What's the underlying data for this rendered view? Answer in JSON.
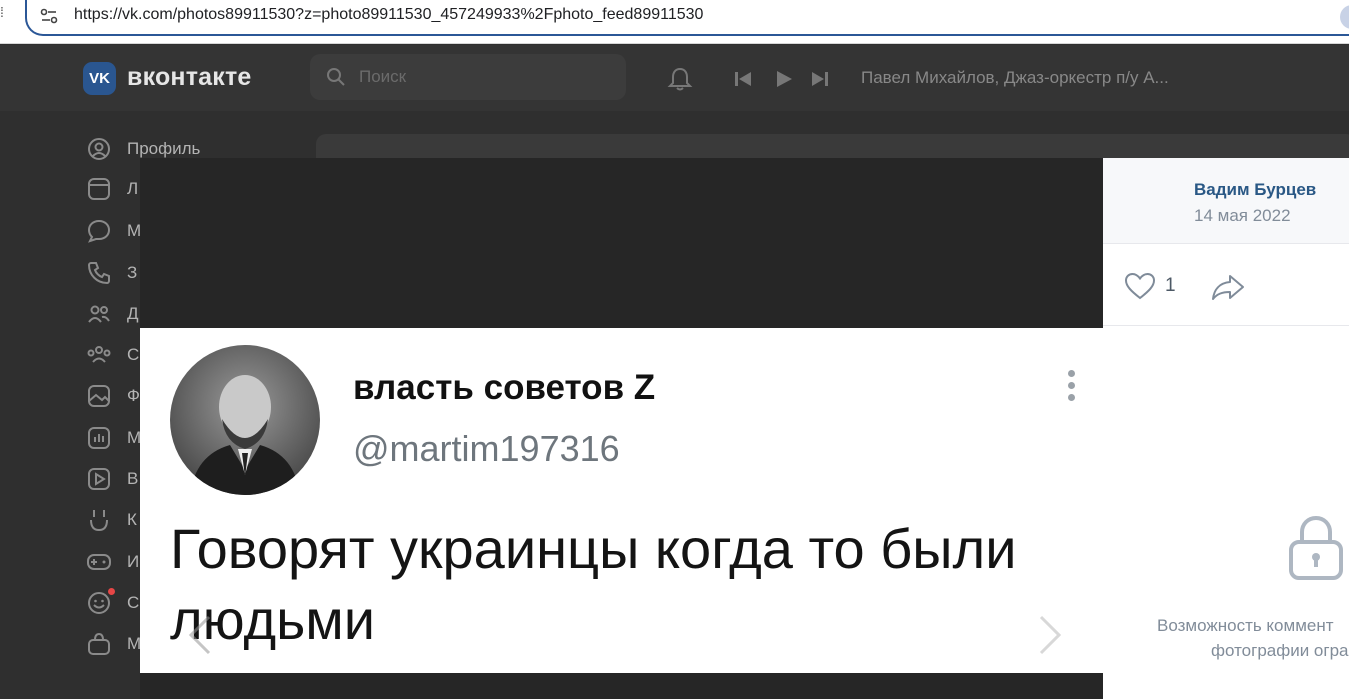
{
  "browser": {
    "url": "https://vk.com/photos89911530?z=photo89911530_457249933%2Fphoto_feed89911530"
  },
  "header": {
    "logo_mark": "VK",
    "brand": "вконтакте",
    "search_placeholder": "Поиск",
    "now_playing": "Павел Михайлов, Джаз-оркестр п/у А..."
  },
  "sidebar": {
    "items": [
      {
        "label": "Профиль",
        "icon": "profile-icon"
      },
      {
        "label": "Л",
        "icon": "news-icon"
      },
      {
        "label": "М",
        "icon": "messages-icon"
      },
      {
        "label": "З",
        "icon": "calls-icon"
      },
      {
        "label": "Д",
        "icon": "friends-icon"
      },
      {
        "label": "С",
        "icon": "communities-icon"
      },
      {
        "label": "Ф",
        "icon": "photos-icon"
      },
      {
        "label": "М",
        "icon": "music-icon"
      },
      {
        "label": "В",
        "icon": "video-icon"
      },
      {
        "label": "К",
        "icon": "clips-icon"
      },
      {
        "label": "И",
        "icon": "games-icon"
      },
      {
        "label": "С",
        "icon": "stickers-icon"
      },
      {
        "label": "М",
        "icon": "market-icon"
      }
    ]
  },
  "photo": {
    "tweet_name": "власть советов Z",
    "tweet_handle": "@martim197316",
    "tweet_text": "Говорят украинцы когда то были людьми"
  },
  "panel": {
    "author": "Вадим Бурцев",
    "date": "14 мая 2022",
    "likes": "1",
    "note_line1": "Возможность коммент",
    "note_line2": "фотографии огра"
  },
  "colors": {
    "vk_blue": "#2a5690",
    "link": "#2a5885",
    "header_bg": "#343434",
    "page_bg": "#2f2f2f"
  }
}
